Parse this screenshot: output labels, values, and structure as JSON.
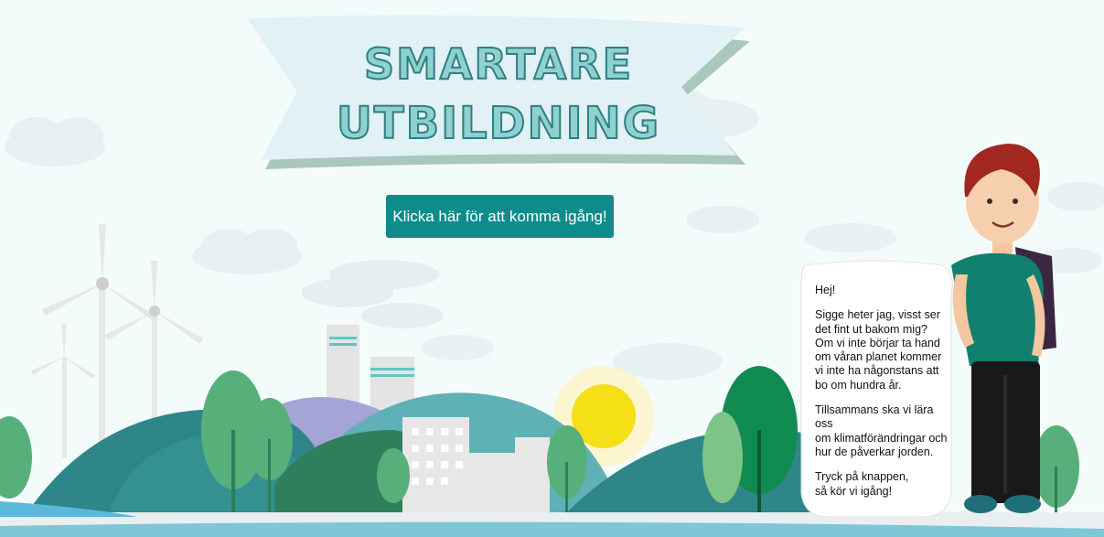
{
  "banner": {
    "line1": "Smartare",
    "line2": "Utbildning"
  },
  "cta": {
    "label": "Klicka här för att komma igång!"
  },
  "speech": {
    "greeting": "Hej!",
    "intro": "Sigge heter jag, visst ser\ndet fint ut bakom mig?\nOm vi inte börjar ta hand\nom våran planet kommer\nvi inte ha någonstans att\nbo om hundra år.",
    "together": "Tillsammans ska vi lära oss\nom klimatförändringar och\nhur de påverkar jorden.",
    "action": "Tryck på knappen,\nså kör vi igång!"
  }
}
